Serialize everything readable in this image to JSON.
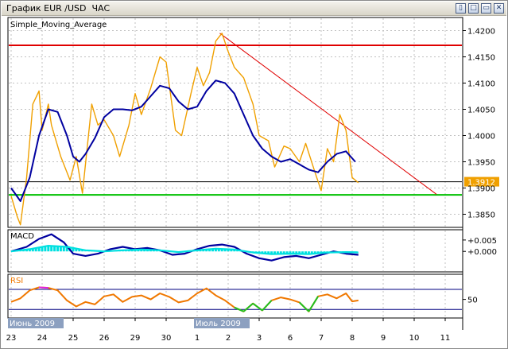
{
  "window": {
    "title": "График EUR /USD  ЧАС",
    "buttons": [
      {
        "name": "restore-window-button",
        "glyph": "▯"
      },
      {
        "name": "maximize-window-button",
        "glyph": "□"
      },
      {
        "name": "minimize-window-button",
        "glyph": "▭"
      },
      {
        "name": "close-window-button",
        "glyph": "✕"
      }
    ]
  },
  "colors": {
    "price": "#f0a000",
    "sma": "#0000a0",
    "resistance": "#e00000",
    "support": "#00c000",
    "current_line": "#000000",
    "current_badge": "#f0a000",
    "macd_main": "#0000a0",
    "macd_signal": "#00e0e0",
    "rsi_line": "#f07800",
    "rsi_high": "#e020e0",
    "rsi_low": "#20c020",
    "grid": "#c0c0c0"
  },
  "chart_data": [
    {
      "type": "line",
      "title": "Simple_Moving_Average",
      "pair": "EUR /USD",
      "timeframe": "ЧАС",
      "ylim": [
        1.3825,
        1.4225
      ],
      "y_ticks": [
        "1.4200",
        "1.4150",
        "1.4100",
        "1.4050",
        "1.4000",
        "1.3950",
        "1.3900",
        "1.3850"
      ],
      "x_ticks": [
        "23",
        "24",
        "25",
        "26",
        "29",
        "30",
        "1",
        "2",
        "3",
        "6",
        "7",
        "8",
        "9",
        "10",
        "11"
      ],
      "x_range": [
        0,
        14
      ],
      "period_labels": [
        "Июнь 2009",
        "Июль 2009"
      ],
      "current_price": "1.3912",
      "horizontal_lines": [
        {
          "name": "resistance",
          "value": 1.4172
        },
        {
          "name": "current",
          "value": 1.3912
        },
        {
          "name": "support",
          "value": 1.3887
        }
      ],
      "trendline": {
        "from": [
          6.73,
          1.4195
        ],
        "to": [
          13.72,
          1.3888
        ]
      },
      "grid": true,
      "series": [
        {
          "role": "price",
          "x": [
            0,
            0.2,
            0.3,
            0.5,
            0.7,
            0.9,
            1.0,
            1.2,
            1.3,
            1.6,
            1.9,
            2.1,
            2.3,
            2.6,
            2.8,
            3.0,
            3.3,
            3.5,
            3.8,
            4.0,
            4.2,
            4.5,
            4.8,
            5.0,
            5.3,
            5.5,
            5.8,
            6.0,
            6.2,
            6.4,
            6.6,
            6.8,
            7.0,
            7.2,
            7.5,
            7.8,
            8.0,
            8.3,
            8.5,
            8.8,
            9.0,
            9.3,
            9.5,
            9.8,
            10.0,
            10.2,
            10.4,
            10.6,
            10.8,
            11.0,
            11.2
          ],
          "y": [
            1.3885,
            1.3845,
            1.383,
            1.392,
            1.406,
            1.4085,
            1.401,
            1.406,
            1.402,
            1.396,
            1.3915,
            1.396,
            1.389,
            1.406,
            1.402,
            1.403,
            1.4,
            1.396,
            1.402,
            1.408,
            1.404,
            1.409,
            1.415,
            1.414,
            1.401,
            1.4,
            1.408,
            1.413,
            1.4095,
            1.412,
            1.418,
            1.4195,
            1.416,
            1.413,
            1.411,
            1.406,
            1.4,
            1.399,
            1.394,
            1.398,
            1.3975,
            1.395,
            1.3985,
            1.393,
            1.3895,
            1.3975,
            1.395,
            1.404,
            1.401,
            1.392,
            1.391
          ]
        },
        {
          "role": "sma",
          "x": [
            0,
            0.3,
            0.6,
            0.9,
            1.2,
            1.5,
            1.8,
            2.0,
            2.2,
            2.4,
            2.7,
            3.0,
            3.3,
            3.6,
            3.9,
            4.2,
            4.5,
            4.8,
            5.1,
            5.4,
            5.7,
            6.0,
            6.3,
            6.6,
            6.9,
            7.2,
            7.5,
            7.8,
            8.1,
            8.4,
            8.7,
            9.0,
            9.3,
            9.6,
            9.9,
            10.2,
            10.5,
            10.8,
            11.1
          ],
          "y": [
            1.39,
            1.3875,
            1.392,
            1.4,
            1.405,
            1.4045,
            1.4,
            1.396,
            1.395,
            1.3965,
            1.3995,
            1.4035,
            1.405,
            1.405,
            1.4048,
            1.4055,
            1.4075,
            1.4095,
            1.409,
            1.4065,
            1.405,
            1.4055,
            1.4085,
            1.4105,
            1.41,
            1.408,
            1.404,
            1.4,
            1.3975,
            1.396,
            1.395,
            1.3955,
            1.3945,
            1.3935,
            1.393,
            1.395,
            1.3965,
            1.397,
            1.395
          ]
        }
      ]
    },
    {
      "type": "line",
      "title": "MACD",
      "ylim": [
        -0.009,
        0.0095
      ],
      "y_ticks": [
        "+0.005",
        "+0.000"
      ],
      "series": [
        {
          "role": "macd_main",
          "x": [
            0,
            0.5,
            0.9,
            1.3,
            1.7,
            2.0,
            2.4,
            2.8,
            3.2,
            3.6,
            4.0,
            4.4,
            4.8,
            5.2,
            5.6,
            6.0,
            6.4,
            6.8,
            7.2,
            7.6,
            8.0,
            8.4,
            8.8,
            9.2,
            9.6,
            10.0,
            10.4,
            10.8,
            11.2
          ],
          "y": [
            0.0,
            0.002,
            0.0055,
            0.0075,
            0.004,
            -0.001,
            -0.002,
            -0.001,
            0.001,
            0.002,
            0.001,
            0.0015,
            0.0005,
            -0.0015,
            -0.001,
            0.001,
            0.0025,
            0.003,
            0.002,
            -0.001,
            -0.003,
            -0.004,
            -0.0025,
            -0.002,
            -0.003,
            -0.0015,
            0.0,
            -0.001,
            -0.0015
          ]
        },
        {
          "role": "macd_signal",
          "x": [
            0,
            0.6,
            1.2,
            1.8,
            2.4,
            3.0,
            3.6,
            4.2,
            4.8,
            5.4,
            6.0,
            6.6,
            7.2,
            7.8,
            8.4,
            9.0,
            9.6,
            10.2,
            10.8,
            11.2
          ],
          "y": [
            0.0,
            0.001,
            0.0025,
            0.002,
            0.0005,
            0.0,
            0.0005,
            0.0008,
            0.0005,
            -0.0003,
            0.0005,
            0.0012,
            0.0008,
            -0.0005,
            -0.0012,
            -0.001,
            -0.0012,
            -0.0005,
            -0.0003,
            -0.0005
          ]
        }
      ]
    },
    {
      "type": "line",
      "title": "RSI",
      "ylim": [
        13,
        100
      ],
      "y_ticks": [
        "50"
      ],
      "levels": [
        70,
        30
      ],
      "series": [
        {
          "role": "rsi",
          "x": [
            0,
            0.3,
            0.6,
            0.9,
            1.2,
            1.5,
            1.8,
            2.1,
            2.4,
            2.7,
            3.0,
            3.3,
            3.6,
            3.9,
            4.2,
            4.5,
            4.8,
            5.1,
            5.4,
            5.7,
            6.0,
            6.3,
            6.6,
            6.9,
            7.2,
            7.5,
            7.8,
            8.1,
            8.4,
            8.7,
            9.0,
            9.3,
            9.6,
            9.9,
            10.2,
            10.5,
            10.8,
            11.0,
            11.2
          ],
          "y": [
            45,
            52,
            68,
            74,
            73,
            68,
            48,
            36,
            45,
            40,
            56,
            60,
            45,
            55,
            58,
            50,
            62,
            55,
            44,
            48,
            62,
            72,
            58,
            48,
            34,
            26,
            42,
            28,
            48,
            54,
            50,
            44,
            26,
            56,
            60,
            52,
            62,
            46,
            48
          ]
        }
      ]
    }
  ]
}
